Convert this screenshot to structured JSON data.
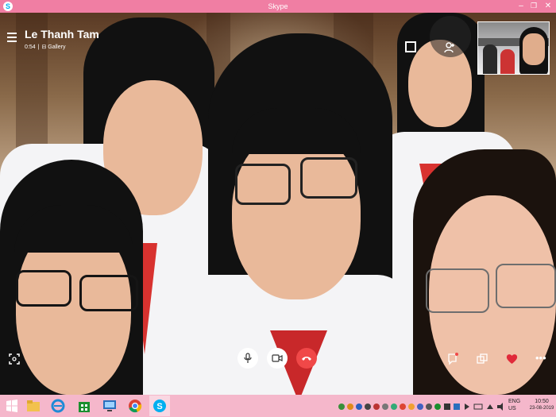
{
  "window": {
    "title": "Skype",
    "app_icon": "S",
    "minimize": "–",
    "restore": "❐",
    "close": "✕",
    "accent": "#f07ea3"
  },
  "call": {
    "caller_name": "Le Thanh Tam",
    "duration": "0:54",
    "separator": "|",
    "view_mode": "Gallery"
  },
  "controls": {
    "mic": "microphone-icon",
    "video": "video-camera-icon",
    "end_call": "end-call-icon",
    "end_call_color": "#f04848"
  },
  "taskbar": {
    "start": "windows-start-icon",
    "apps": [
      "file-explorer-icon",
      "internet-explorer-icon",
      "store-icon",
      "this-pc-icon",
      "chrome-icon",
      "skype-icon"
    ],
    "language": "ENG",
    "region": "US",
    "time": "10:50",
    "date": "23-08-2019"
  }
}
